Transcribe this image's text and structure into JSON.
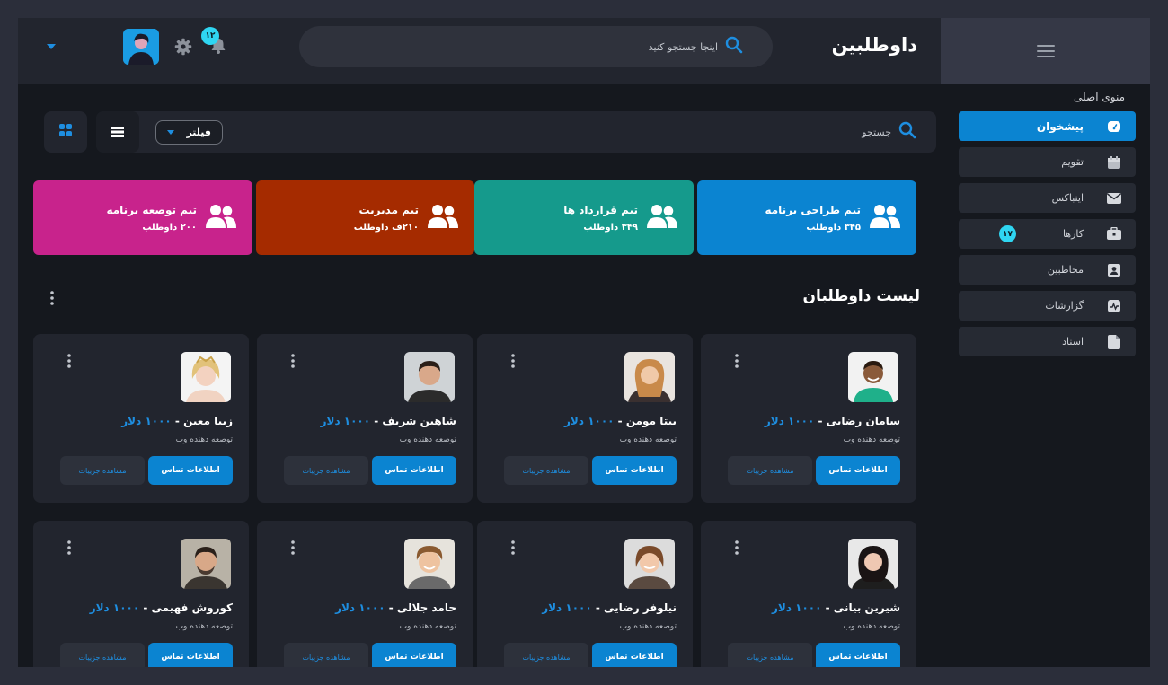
{
  "header": {
    "title": "داوطلبین",
    "search_placeholder": "اینجا جستجو کنید",
    "notification_count": "۱۲"
  },
  "sidebar": {
    "menu_title": "منوی اصلی",
    "items": [
      {
        "label": "پیشخوان",
        "icon": "dashboard-icon",
        "active": true
      },
      {
        "label": "تقویم",
        "icon": "calendar-icon"
      },
      {
        "label": "اینباکس",
        "icon": "mail-icon"
      },
      {
        "label": "کارها",
        "icon": "briefcase-icon",
        "badge": "۱۷"
      },
      {
        "label": "مخاطبین",
        "icon": "contact-card-icon"
      },
      {
        "label": "گزارشات",
        "icon": "activity-icon"
      },
      {
        "label": "اسناد",
        "icon": "document-icon"
      }
    ]
  },
  "toolbar": {
    "search_placeholder": "جستجو",
    "filter_label": "فیلتر"
  },
  "teams": [
    {
      "name": "تیم طراحی برنامه",
      "count": "۳۴۵ داوطلب",
      "color": "#0b84d1"
    },
    {
      "name": "تیم قرارداد ها",
      "count": "۳۴۹ داوطلب",
      "color": "#159a8c"
    },
    {
      "name": "تیم مدیریت",
      "count": "۲۱۰ف داوطلب",
      "color": "#a52b00"
    },
    {
      "name": "تیم توصعه برنامه",
      "count": "۲۰۰ داوطلب",
      "color": "#c8238c"
    }
  ],
  "section": {
    "title": "لیست داوطلبان"
  },
  "members": [
    {
      "name": "سامان رضایی",
      "price": "۱۰۰۰ دلار",
      "role": "توصعه دهنده وب",
      "contact": "اطلاعات تماس",
      "details": "مشاهده جزییات"
    },
    {
      "name": "بیتا مومن",
      "price": "۱۰۰۰ دلار",
      "role": "توصعه دهنده وب",
      "contact": "اطلاعات تماس",
      "details": "مشاهده جزییات"
    },
    {
      "name": "شاهین شریف",
      "price": "۱۰۰۰ دلار",
      "role": "توصعه دهنده وب",
      "contact": "اطلاعات تماس",
      "details": "مشاهده جزییات"
    },
    {
      "name": "زیبا معین",
      "price": "۱۰۰۰ دلار",
      "role": "توصعه دهنده وب",
      "contact": "اطلاعات تماس",
      "details": "مشاهده جزییات"
    },
    {
      "name": "شیرین بیانی",
      "price": "۱۰۰۰ دلار",
      "role": "توصعه دهنده وب",
      "contact": "اطلاعات تماس",
      "details": "مشاهده جزییات"
    },
    {
      "name": "نیلوفر رضایی",
      "price": "۱۰۰۰ دلار",
      "role": "توصعه دهنده وب",
      "contact": "اطلاعات تماس",
      "details": "مشاهده جزییات"
    },
    {
      "name": "حامد جلالی",
      "price": "۱۰۰۰ دلار",
      "role": "توصعه دهنده وب",
      "contact": "اطلاعات تماس",
      "details": "مشاهده جزییات"
    },
    {
      "name": "کوروش فهیمی",
      "price": "۱۰۰۰ دلار",
      "role": "توصعه دهنده وب",
      "contact": "اطلاعات تماس",
      "details": "مشاهده جزییات"
    }
  ],
  "colors": {
    "accent": "#0b84d1",
    "badge": "#2fd6f2"
  }
}
